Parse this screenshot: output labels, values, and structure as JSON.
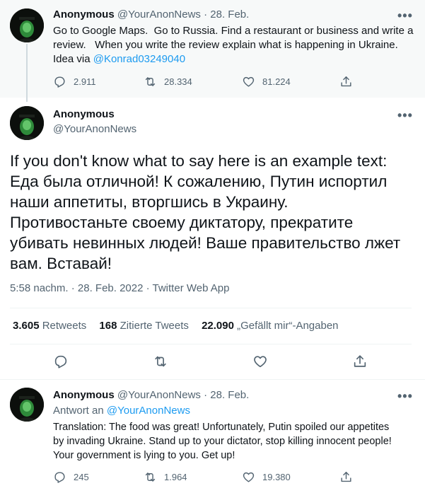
{
  "tweet1": {
    "name": "Anonymous",
    "handle": "@YourAnonNews",
    "sep": "·",
    "date": "28. Feb.",
    "more": "•••",
    "line1": "Go to Google Maps.  Go to Russia. Find a restaurant or business and write a",
    "line2": "review.   When you write the review explain what is happening in Ukraine.",
    "line3_prefix": "Idea via",
    "line3_link": "@Konrad03249040",
    "replies": "2.911",
    "retweets": "28.334",
    "likes": "81.224"
  },
  "main": {
    "name": "Anonymous",
    "handle": "@YourAnonNews",
    "more": "•••",
    "text": [
      "If you don't know what to say here is an example text:",
      "Еда была отличной! К сожалению, Путин испортил",
      "наши аппетиты, вторгшись в Украину.",
      "Противостаньте своему диктатору, прекратите",
      "убивать невинных людей! Ваше правительство лжет",
      "вам. Вставай!"
    ],
    "meta": "5:58 nachm. · 28. Feb. 2022 · Twitter Web App",
    "retweets_count": "3.605",
    "retweets_label": "Retweets",
    "quotes_count": "168",
    "quotes_label": "Zitierte Tweets",
    "likes_count": "22.090",
    "likes_label": "„Gefällt mir“-Angaben"
  },
  "reply": {
    "name": "Anonymous",
    "handle": "@YourAnonNews",
    "sep": "·",
    "date": "28. Feb.",
    "more": "•••",
    "reply_to_prefix": "Antwort an",
    "reply_to_handle": "@YourAnonNews",
    "lines": [
      "Translation: The food was great! Unfortunately, Putin spoiled our appetites",
      "by invading Ukraine. Stand up to your dictator, stop killing innocent people!",
      "Your government is lying to you. Get up!"
    ],
    "replies": "245",
    "retweets": "1.964",
    "likes": "19.380"
  },
  "colors": {
    "accent": "#1d9bf0",
    "text": "#0f1419",
    "muted": "#536471",
    "top_bg": "#f7f9f9"
  },
  "icons": {
    "reply": "reply-icon",
    "retweet": "retweet-icon",
    "like": "heart-icon",
    "share": "share-icon"
  }
}
